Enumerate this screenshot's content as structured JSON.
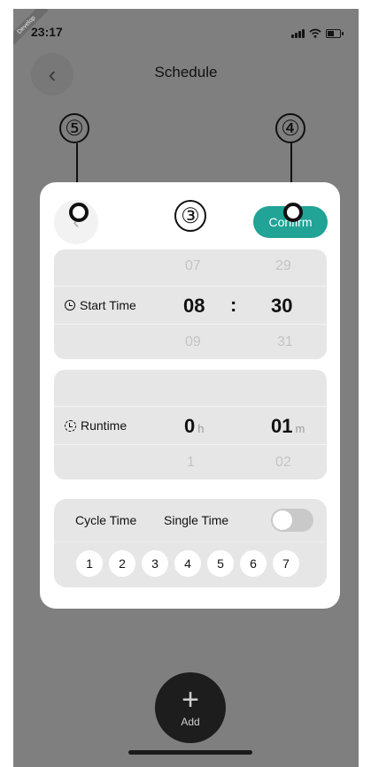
{
  "status_bar": {
    "time": "23:17",
    "dev_badge": "Develop"
  },
  "nav": {
    "title": "Schedule",
    "back_icon": "‹"
  },
  "callouts": {
    "back": "⑤",
    "confirm": "④",
    "title": "③"
  },
  "dialog": {
    "back_icon": "‹",
    "confirm_label": "Confirm",
    "start_time": {
      "label": "Start Time",
      "hour_prev": "07",
      "hour": "08",
      "hour_next": "09",
      "separator": ":",
      "minute_prev": "29",
      "minute": "30",
      "minute_next": "31"
    },
    "runtime": {
      "label": "Runtime",
      "hours": "0",
      "hours_unit": "h",
      "hours_next": "1",
      "minutes": "01",
      "minutes_unit": "m",
      "minutes_next": "02"
    },
    "cycle": {
      "cycle_label": "Cycle Time",
      "single_label": "Single Time",
      "single_enabled": false,
      "days": [
        "1",
        "2",
        "3",
        "4",
        "5",
        "6",
        "7"
      ]
    }
  },
  "add": {
    "plus": "+",
    "label": "Add"
  },
  "colors": {
    "accent": "#21a396",
    "overlay": "#7e7f7e",
    "panel": "#e6e6e6"
  }
}
